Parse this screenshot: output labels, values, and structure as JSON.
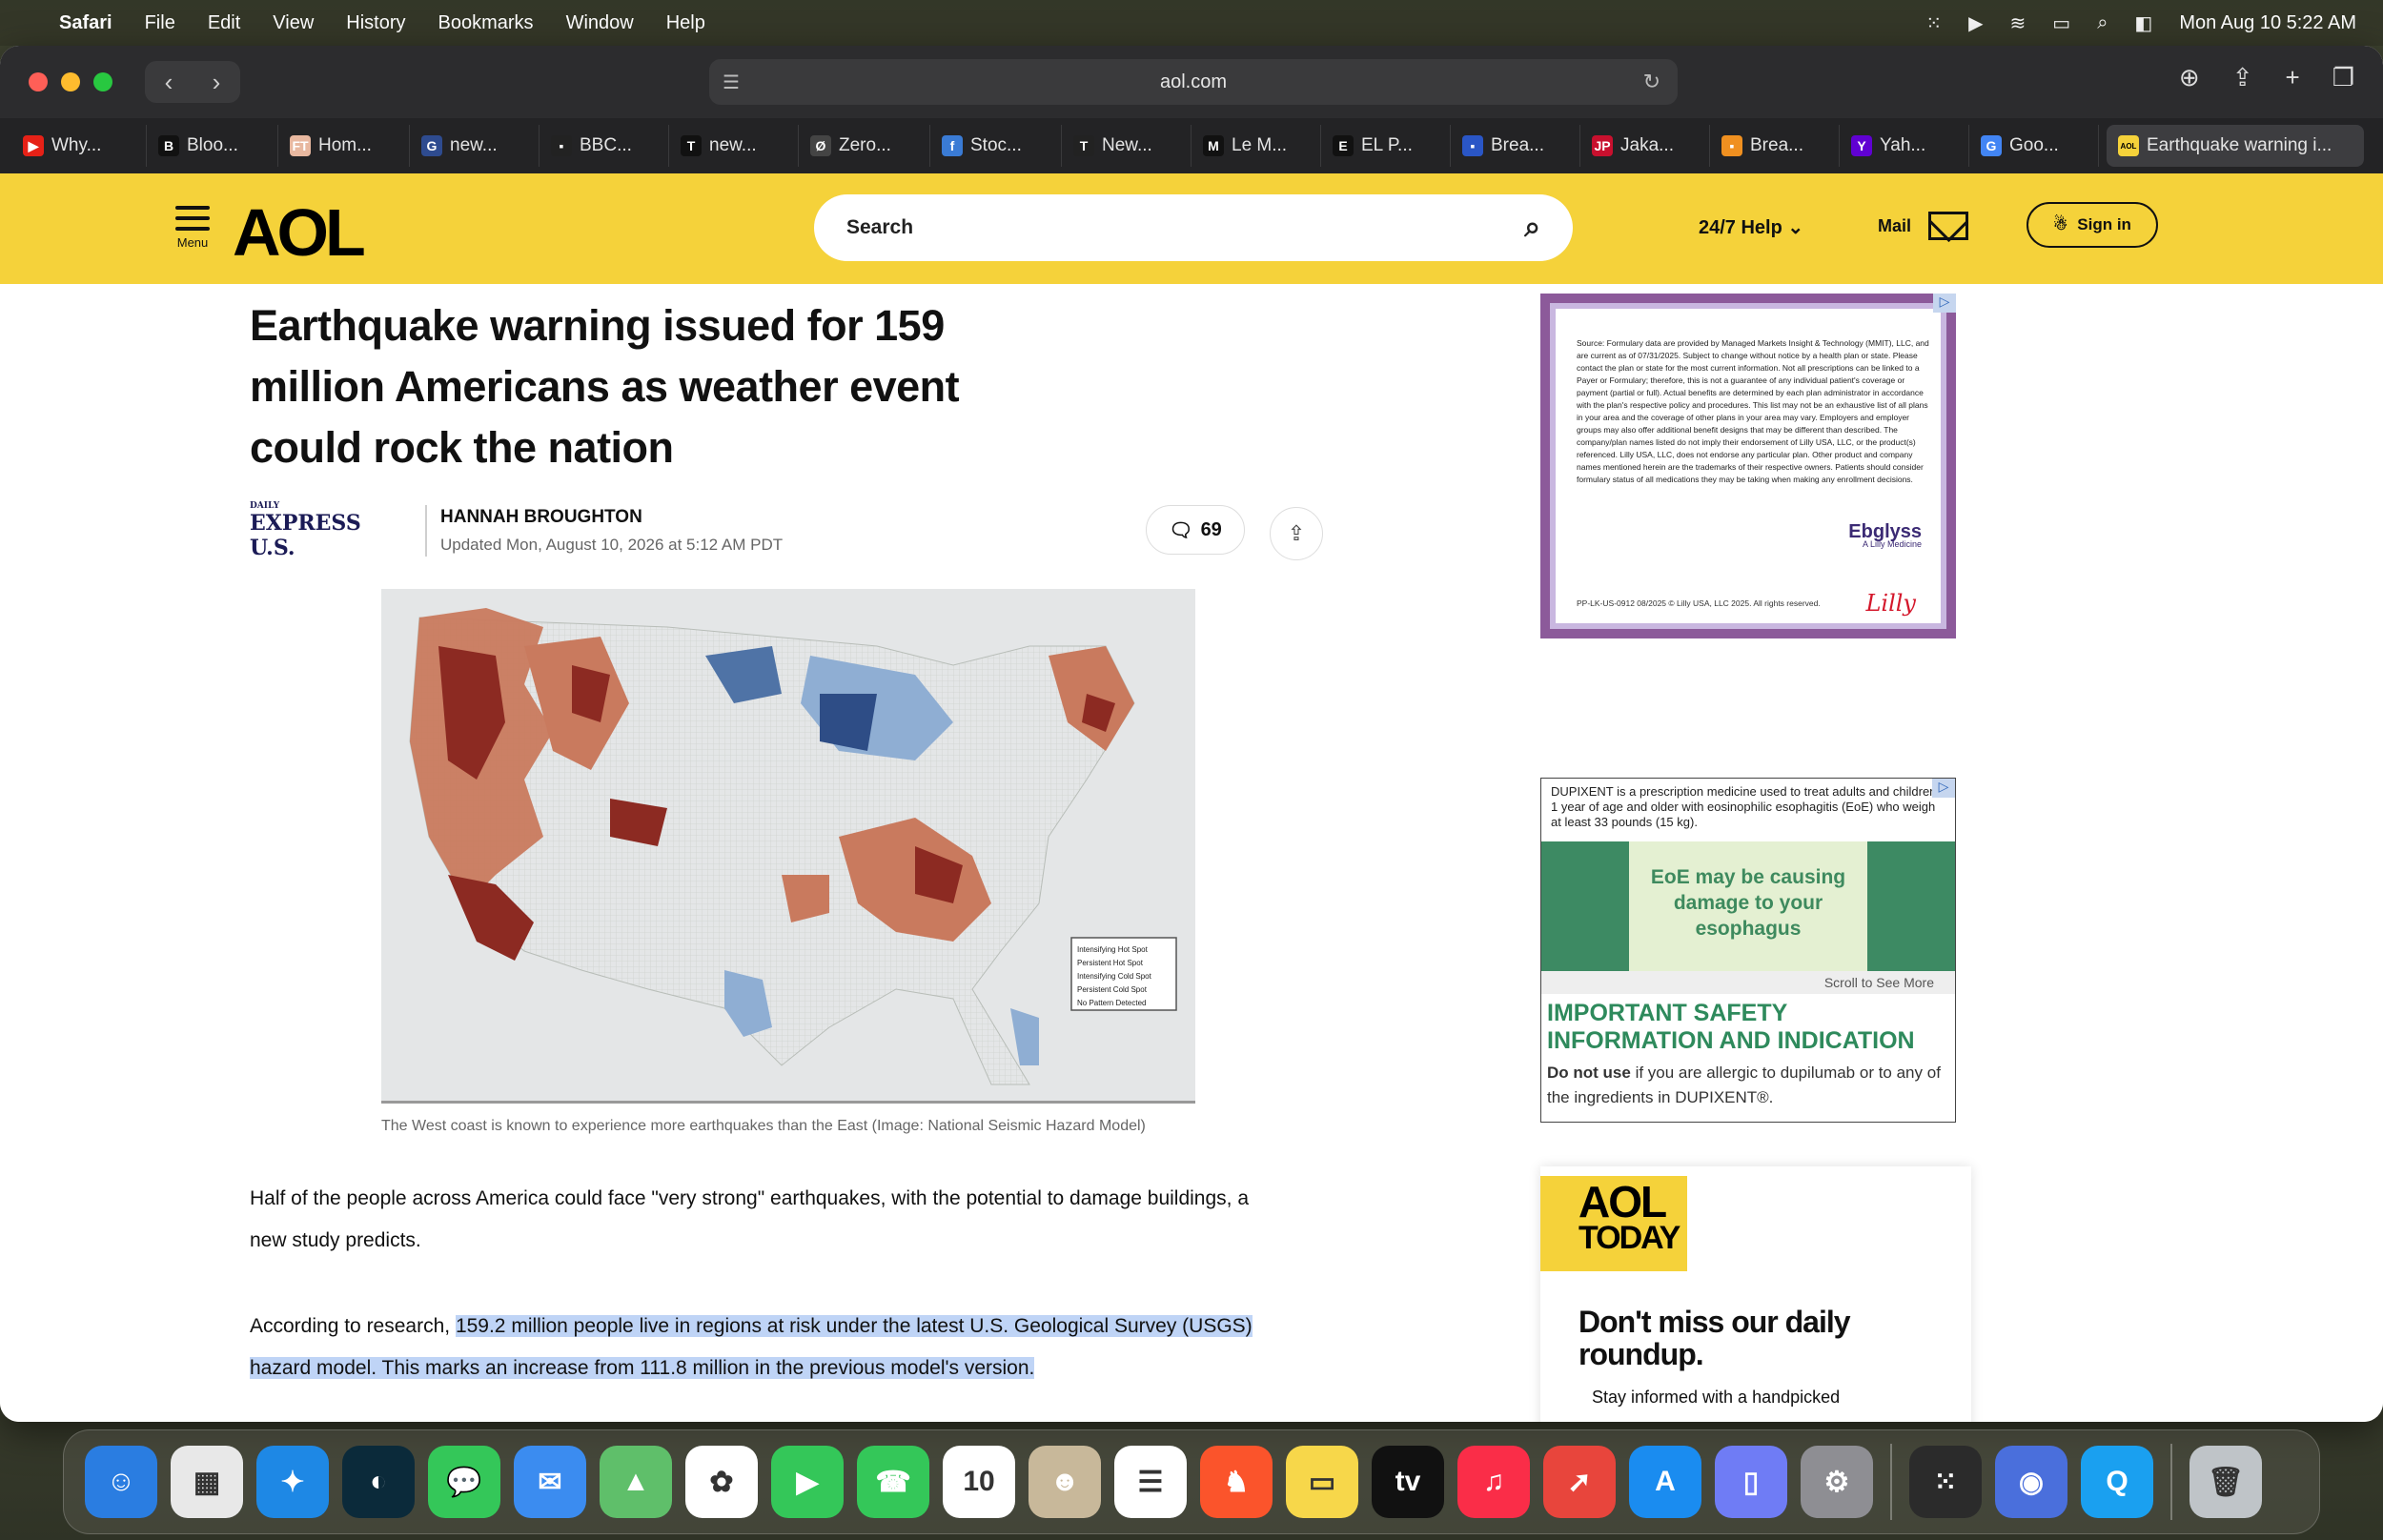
{
  "menubar": {
    "app": "Safari",
    "items": [
      "File",
      "Edit",
      "View",
      "History",
      "Bookmarks",
      "Window",
      "Help"
    ],
    "clock": "Mon Aug 10  5:22 AM"
  },
  "browser": {
    "address": "aol.com",
    "tabs": [
      {
        "label": "Why...",
        "fav": "▶",
        "color": "#e62117"
      },
      {
        "label": "Bloo...",
        "fav": "B",
        "color": "#111"
      },
      {
        "label": "Hom...",
        "fav": "FT",
        "color": "#e8b8a0"
      },
      {
        "label": "new...",
        "fav": "G",
        "color": "#2e4b8f"
      },
      {
        "label": "BBC...",
        "fav": "▪",
        "color": "#222"
      },
      {
        "label": "new...",
        "fav": "T",
        "color": "#111"
      },
      {
        "label": "Zero...",
        "fav": "Ø",
        "color": "#444"
      },
      {
        "label": "Stoc...",
        "fav": "f",
        "color": "#3a7bd5"
      },
      {
        "label": "New...",
        "fav": "T",
        "color": "#222"
      },
      {
        "label": "Le M...",
        "fav": "M",
        "color": "#111"
      },
      {
        "label": "EL P...",
        "fav": "E",
        "color": "#111"
      },
      {
        "label": "Brea...",
        "fav": "▪",
        "color": "#2a56c6"
      },
      {
        "label": "Jaka...",
        "fav": "JP",
        "color": "#c8102e"
      },
      {
        "label": "Brea...",
        "fav": "▪",
        "color": "#f09020"
      },
      {
        "label": "Yah...",
        "fav": "Y",
        "color": "#6001d2"
      },
      {
        "label": "Goo...",
        "fav": "G",
        "color": "#4285f4"
      },
      {
        "label": "Earthquake warning i...",
        "fav": "AOL",
        "color": "#f5d23a"
      }
    ]
  },
  "aol": {
    "menu_label": "Menu",
    "logo": "AOL",
    "search_placeholder": "Search",
    "help": "24/7 Help",
    "mail": "Mail",
    "signin": "Sign in"
  },
  "article": {
    "headline": "Earthquake warning issued for 159 million Americans as weather event could rock the nation",
    "publisher": "EXPRESS U.S.",
    "publisher_small": "DAILY",
    "author": "HANNAH BROUGHTON",
    "updated": "Updated Mon, August 10, 2026 at 5:12 AM PDT",
    "comments": "69",
    "caption": "The West coast is known to experience more earthquakes than the East (Image: National Seismic Hazard Model)",
    "legend": [
      "Intensifying Hot Spot",
      "Persistent Hot Spot",
      "Intensifying Cold Spot",
      "Persistent Cold Spot",
      "No Pattern Detected"
    ],
    "para1": "Half of the people across America could face \"very strong\" earthquakes, with the potential to damage buildings, a new study predicts.",
    "para2_lead": "According to research, ",
    "para2_highlight": "159.2 million people live in regions at risk under the latest U.S. Geological Survey (USGS) hazard model. This marks an increase from 111.8 million in the previous model's version."
  },
  "ads": {
    "ebglyss_text": "Source: Formulary data are provided by Managed Markets Insight & Technology (MMIT), LLC, and are current as of 07/31/2025. Subject to change without notice by a health plan or state. Please contact the plan or state for the most current information. Not all prescriptions can be linked to a Payer or Formulary; therefore, this is not a guarantee of any individual patient's coverage or payment (partial or full). Actual benefits are determined by each plan administrator in accordance with the plan's respective policy and procedures. This list may not be an exhaustive list of all plans in your area and the coverage of other plans in your area may vary. Employers and employer groups may also offer additional benefit designs that may be different than described. The company/plan names listed do not imply their endorsement of Lilly USA, LLC, or the product(s) referenced. Lilly USA, LLC, does not endorse any particular plan. Other product and company names mentioned herein are the trademarks of their respective owners. Patients should consider formulary status of all medications they may be taking when making any enrollment decisions.",
    "ebglyss_brand": "Ebglyss",
    "ebglyss_brand_sub": "A Lilly Medicine",
    "ebglyss_foot": "PP-LK-US-0912 08/2025 © Lilly USA, LLC 2025. All rights reserved.",
    "lilly": "Lilly",
    "dupixent_top": "DUPIXENT is a prescription medicine used to treat adults and children 1 year of age and older with eosinophilic esophagitis (EoE) who weigh at least 33 pounds (15 kg).",
    "dupixent_banner": "EoE may be causing damage to your esophagus",
    "dupixent_scroll": "Scroll to See More",
    "dupixent_safety": "IMPORTANT SAFETY INFORMATION AND INDICATION",
    "dupixent_bold": "Do not use",
    "dupixent_rest": " if you are allergic to dupilumab or to any of the ingredients in DUPIXENT®.",
    "aoltoday_logo1": "AOL",
    "aoltoday_logo2": "TODAY",
    "aoltoday_promo": "Don't miss our daily roundup.",
    "aoltoday_sub": "Stay informed with a handpicked"
  },
  "dock": [
    {
      "name": "finder",
      "glyph": "☺",
      "bg": "#2a7de1"
    },
    {
      "name": "launchpad",
      "glyph": "▦",
      "bg": "#e8e8e8"
    },
    {
      "name": "safari",
      "glyph": "✦",
      "bg": "#1e88e5"
    },
    {
      "name": "app-dark",
      "glyph": "◐",
      "bg": "#0b2a3a"
    },
    {
      "name": "messages",
      "glyph": "💬",
      "bg": "#34c759"
    },
    {
      "name": "mail",
      "glyph": "✉",
      "bg": "#3b8cf0"
    },
    {
      "name": "maps",
      "glyph": "▲",
      "bg": "#5fbf6a"
    },
    {
      "name": "photos",
      "glyph": "✿",
      "bg": "#ffffff"
    },
    {
      "name": "facetime",
      "glyph": "▶",
      "bg": "#34c759"
    },
    {
      "name": "phone",
      "glyph": "☎",
      "bg": "#34c759"
    },
    {
      "name": "calendar",
      "glyph": "10",
      "bg": "#ffffff"
    },
    {
      "name": "contacts",
      "glyph": "☻",
      "bg": "#c8b89a"
    },
    {
      "name": "reminders",
      "glyph": "☰",
      "bg": "#ffffff"
    },
    {
      "name": "brave",
      "glyph": "♞",
      "bg": "#fb542b"
    },
    {
      "name": "notes",
      "glyph": "▭",
      "bg": "#f7d74a"
    },
    {
      "name": "appletv",
      "glyph": "tv",
      "bg": "#111111"
    },
    {
      "name": "music",
      "glyph": "♫",
      "bg": "#fa2d48"
    },
    {
      "name": "rocket",
      "glyph": "➚",
      "bg": "#e8453c"
    },
    {
      "name": "appstore",
      "glyph": "A",
      "bg": "#1a8cf0"
    },
    {
      "name": "phone-mirror",
      "glyph": "▯",
      "bg": "#6f7cf5"
    },
    {
      "name": "settings",
      "glyph": "⚙",
      "bg": "#8e8e93"
    },
    {
      "name": "sep",
      "glyph": "",
      "bg": ""
    },
    {
      "name": "apps-grid",
      "glyph": "⁙",
      "bg": "#2b2b2b"
    },
    {
      "name": "app-blue",
      "glyph": "◉",
      "bg": "#4a6fdc"
    },
    {
      "name": "app-q",
      "glyph": "Q",
      "bg": "#1aa0f0"
    },
    {
      "name": "sep",
      "glyph": "",
      "bg": ""
    },
    {
      "name": "trash",
      "glyph": "🗑",
      "bg": "#bfc4c8"
    }
  ]
}
